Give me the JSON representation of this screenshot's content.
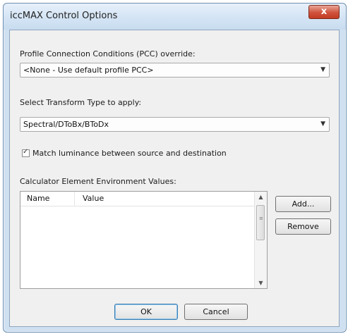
{
  "window": {
    "title": "iccMAX Control Options",
    "close_label": "x"
  },
  "pcc": {
    "label": "Profile Connection Conditions (PCC) override:",
    "selected": "<None - Use default profile PCC>"
  },
  "transform": {
    "label": "Select Transform Type to apply:",
    "selected": "Spectral/DToBx/BToDx"
  },
  "match_luminance": {
    "label": "Match luminance between source and destination",
    "checked": true,
    "check_glyph": "✓"
  },
  "calculator": {
    "label": "Calculator Element Environment Values:",
    "columns": [
      "Name",
      "Value"
    ],
    "rows": []
  },
  "buttons": {
    "add": "Add...",
    "remove": "Remove",
    "ok": "OK",
    "cancel": "Cancel"
  },
  "icons": {
    "dropdown": "▼",
    "scroll_up": "▲",
    "scroll_down": "▼",
    "grip": "≡"
  }
}
